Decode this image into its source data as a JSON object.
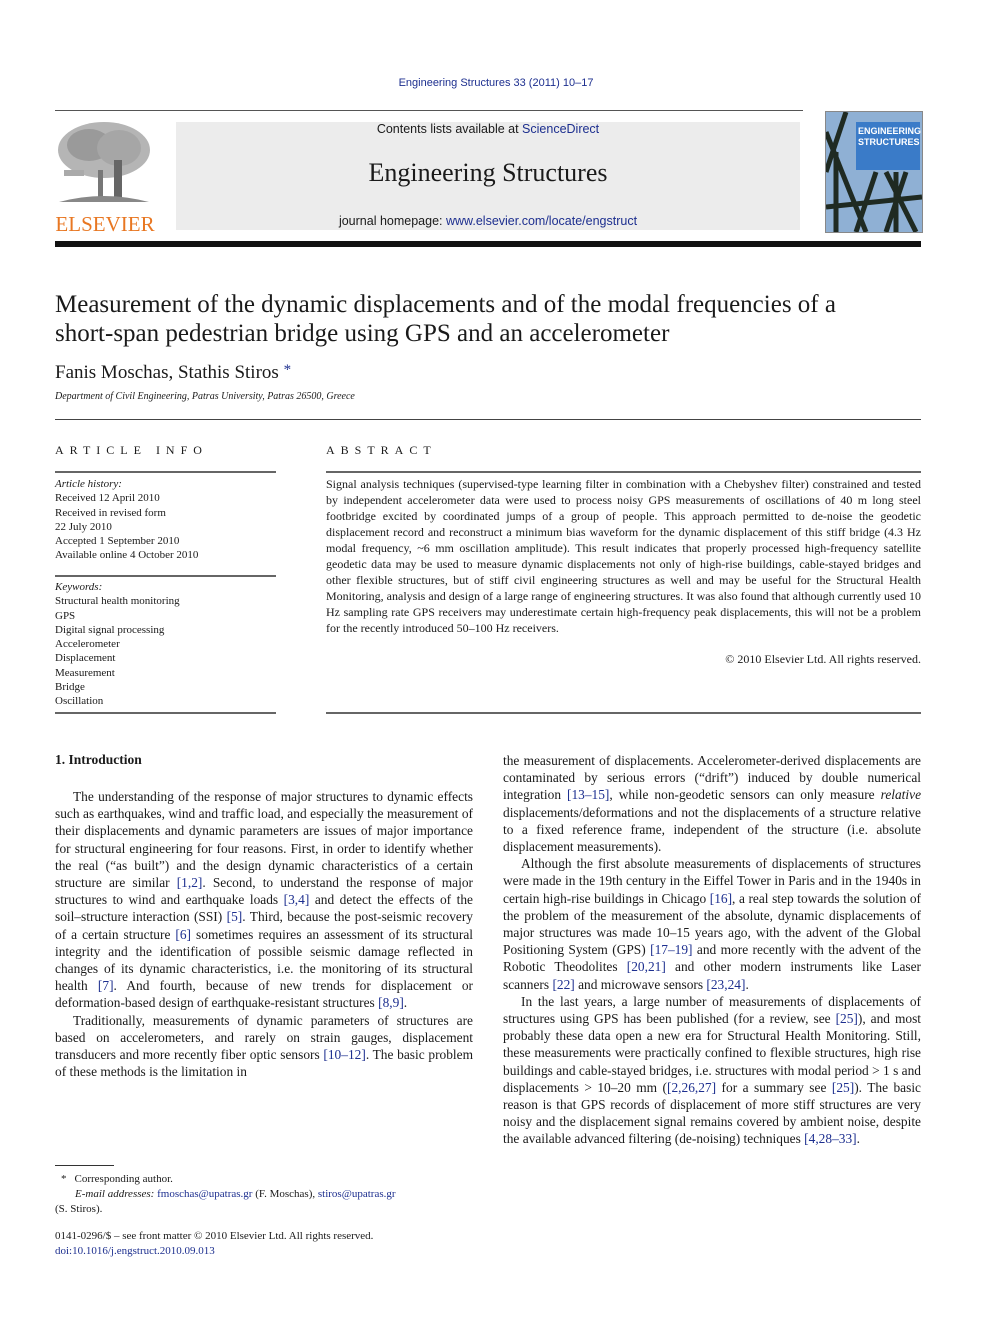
{
  "journal_ref": "Engineering Structures 33 (2011) 10–17",
  "publisher": {
    "wordmark": "ELSEVIER",
    "logo_color": "#e87722"
  },
  "banner": {
    "contents_prefix": "Contents lists available at ",
    "contents_link": "ScienceDirect",
    "journal_title": "Engineering Structures",
    "homepage_prefix": "journal homepage: ",
    "homepage_link": "www.elsevier.com/locate/engstruct"
  },
  "cover": {
    "title_line1": "ENGINEERING",
    "title_line2": "STRUCTURES"
  },
  "article": {
    "title_line1": "Measurement of the dynamic displacements and of the modal frequencies of a",
    "title_line2": "short-span pedestrian bridge using GPS and an accelerometer",
    "authors": "Fanis Moschas, Stathis Stiros",
    "author_mark": "*",
    "affiliation": "Department of Civil Engineering, Patras University, Patras 26500, Greece"
  },
  "article_info": {
    "heading": "ARTICLE INFO",
    "history_label": "Article history:",
    "history": [
      "Received 12 April 2010",
      "Received in revised form",
      "22 July 2010",
      "Accepted 1 September 2010",
      "Available online 4 October 2010"
    ],
    "keywords_label": "Keywords:",
    "keywords": [
      "Structural health monitoring",
      "GPS",
      "Digital signal processing",
      "Accelerometer",
      "Displacement",
      "Measurement",
      "Bridge",
      "Oscillation"
    ]
  },
  "abstract": {
    "heading": "ABSTRACT",
    "text": "Signal analysis techniques (supervised-type learning filter in combination with a Chebyshev filter) constrained and tested by independent accelerometer data were used to process noisy GPS measurements of oscillations of 40 m long steel footbridge excited by coordinated jumps of a group of people. This approach permitted to de-noise the geodetic displacement record and reconstruct a minimum bias waveform for the dynamic displacement of this stiff bridge (4.3 Hz modal frequency, ~6 mm oscillation amplitude). This result indicates that properly processed high-frequency satellite geodetic data may be used to measure dynamic displacements not only of high-rise buildings, cable-stayed bridges and other flexible structures, but of stiff civil engineering structures as well and may be useful for the Structural Health Monitoring, analysis and design of a large range of engineering structures. It was also found that although currently used 10 Hz sampling rate GPS receivers may underestimate certain high-frequency peak displacements, this will not be a problem for the recently introduced 50–100 Hz receivers.",
    "copyright": "© 2010 Elsevier Ltd. All rights reserved."
  },
  "introduction": {
    "heading": "1.  Introduction",
    "left_paragraphs": [
      [
        {
          "t": "The understanding of the response of major structures to dynamic effects such as earthquakes, wind and traffic load, and especially the measurement of their displacements and dynamic parameters are issues of major importance for structural engineering for four reasons. First, in order to identify whether the real (“as built”) and the design dynamic characteristics of a certain structure are similar "
        },
        {
          "t": "[1,2]",
          "ref": true
        },
        {
          "t": ". Second, to understand the response of major structures to wind and earthquake loads "
        },
        {
          "t": "[3,4]",
          "ref": true
        },
        {
          "t": " and detect the effects of the soil–structure interaction (SSI) "
        },
        {
          "t": "[5]",
          "ref": true
        },
        {
          "t": ". Third, because the post-seismic recovery of a certain structure "
        },
        {
          "t": "[6]",
          "ref": true
        },
        {
          "t": " sometimes requires an assessment of its structural integrity and the identification of possible seismic damage reflected in changes of its dynamic characteristics, i.e. the monitoring of its structural health "
        },
        {
          "t": "[7]",
          "ref": true
        },
        {
          "t": ". And fourth, because of new trends for displacement or deformation-based design of earthquake-resistant structures "
        },
        {
          "t": "[8,9]",
          "ref": true
        },
        {
          "t": "."
        }
      ],
      [
        {
          "t": "Traditionally, measurements of dynamic parameters of structures are based on accelerometers, and rarely on strain gauges, displacement transducers and more recently fiber optic sensors "
        },
        {
          "t": "[10–12]",
          "ref": true
        },
        {
          "t": ". The basic problem of these methods is the limitation in"
        }
      ]
    ],
    "right_paragraphs": [
      [
        {
          "t": "the measurement of displacements. Accelerometer-derived displacements are contaminated by serious errors (“drift”) induced by double numerical integration "
        },
        {
          "t": "[13–15]",
          "ref": true
        },
        {
          "t": ", while non-geodetic sensors can only measure "
        },
        {
          "t": "relative",
          "em": true
        },
        {
          "t": " displacements/deformations and not the displacements of a structure relative to a fixed reference frame, independent of the structure (i.e. absolute displacement measurements)."
        }
      ],
      [
        {
          "t": "Although the first absolute measurements of displacements of structures were made in the 19th century in the Eiffel Tower in Paris and in the 1940s in certain high-rise buildings in Chicago "
        },
        {
          "t": "[16]",
          "ref": true
        },
        {
          "t": ", a real step towards the solution of the problem of the measurement of the absolute, dynamic displacements of major structures was made 10–15 years ago, with the advent of the Global Positioning System (GPS) "
        },
        {
          "t": "[17–19]",
          "ref": true
        },
        {
          "t": " and more recently with the advent of the Robotic Theodolites "
        },
        {
          "t": "[20,21]",
          "ref": true
        },
        {
          "t": " and other modern instruments like Laser scanners "
        },
        {
          "t": "[22]",
          "ref": true
        },
        {
          "t": " and microwave sensors "
        },
        {
          "t": "[23,24]",
          "ref": true
        },
        {
          "t": "."
        }
      ],
      [
        {
          "t": "In the last years, a large number of measurements of displacements of structures using GPS has been published (for a review, see "
        },
        {
          "t": "[25]",
          "ref": true
        },
        {
          "t": "), and most probably these data open a new era for Structural Health Monitoring. Still, these measurements were practically confined to flexible structures, high rise buildings and cable-stayed bridges, i.e. structures with modal period  > 1 s and displacements  > 10–20 mm ("
        },
        {
          "t": "[2,26,27]",
          "ref": true
        },
        {
          "t": " for a summary see "
        },
        {
          "t": "[25]",
          "ref": true
        },
        {
          "t": "). The basic reason is that GPS records of displacement of more stiff structures are very noisy and the displacement signal remains covered by ambient noise, despite the available advanced filtering (de-noising) techniques "
        },
        {
          "t": "[4,28–33]",
          "ref": true
        },
        {
          "t": "."
        }
      ]
    ]
  },
  "footnote": {
    "mark": "*",
    "corresponding": "Corresponding author.",
    "email_label": "E-mail addresses:",
    "email1": "fmoschas@upatras.gr",
    "email1_name": " (F. Moschas), ",
    "email2": "stiros@upatras.gr",
    "email2_name": "(S. Stiros)."
  },
  "issn": {
    "line": "0141-0296/$ – see front matter © 2010 Elsevier Ltd. All rights reserved.",
    "doi": "doi:10.1016/j.engstruct.2010.09.013"
  },
  "colors": {
    "link": "#1d2f8f",
    "banner_bg": "#ececec",
    "elsevier_orange": "#e87722"
  }
}
